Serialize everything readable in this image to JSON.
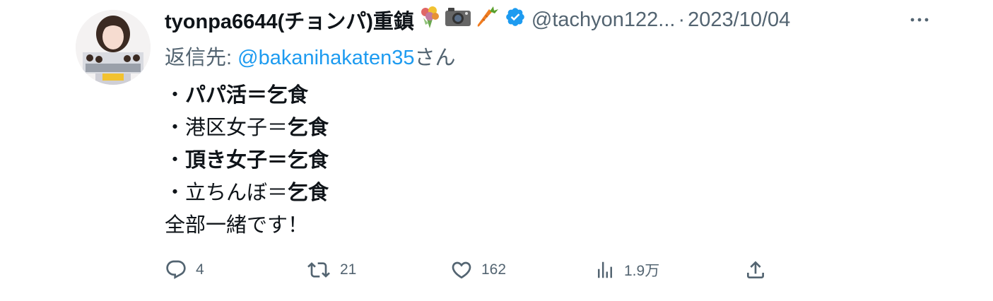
{
  "tweet": {
    "display_name": "tyonpa6644(チョンパ)重鎮",
    "name_emojis": [
      "bouquet-emoji",
      "camera-emoji",
      "carrot-emoji"
    ],
    "handle": "@tachyon122...",
    "separator": "·",
    "date": "2023/10/04",
    "reply_prefix": "返信先: ",
    "reply_mention": "@bakanihakaten35",
    "reply_suffix": "さん",
    "lines": [
      {
        "bullet": "・",
        "head": "パパ活＝",
        "tail": "乞食"
      },
      {
        "bullet": "・",
        "head": "港区女子＝",
        "tail": "乞食"
      },
      {
        "bullet": "・",
        "head": "頂き女子＝",
        "tail": "乞食"
      },
      {
        "bullet": "・",
        "head": "立ちんぼ＝",
        "tail": "乞食"
      }
    ],
    "closing": "全部一緒です！"
  },
  "actions": {
    "reply_count": "4",
    "retweet_count": "21",
    "like_count": "162",
    "view_count": "1.9万"
  },
  "colors": {
    "text": "#0f1419",
    "secondary": "#536471",
    "link": "#1d9bf0",
    "verified": "#1d9bf0"
  },
  "icons": [
    "avatar",
    "verified-badge-icon",
    "more-icon",
    "reply-icon",
    "retweet-icon",
    "like-icon",
    "views-icon",
    "share-icon"
  ]
}
